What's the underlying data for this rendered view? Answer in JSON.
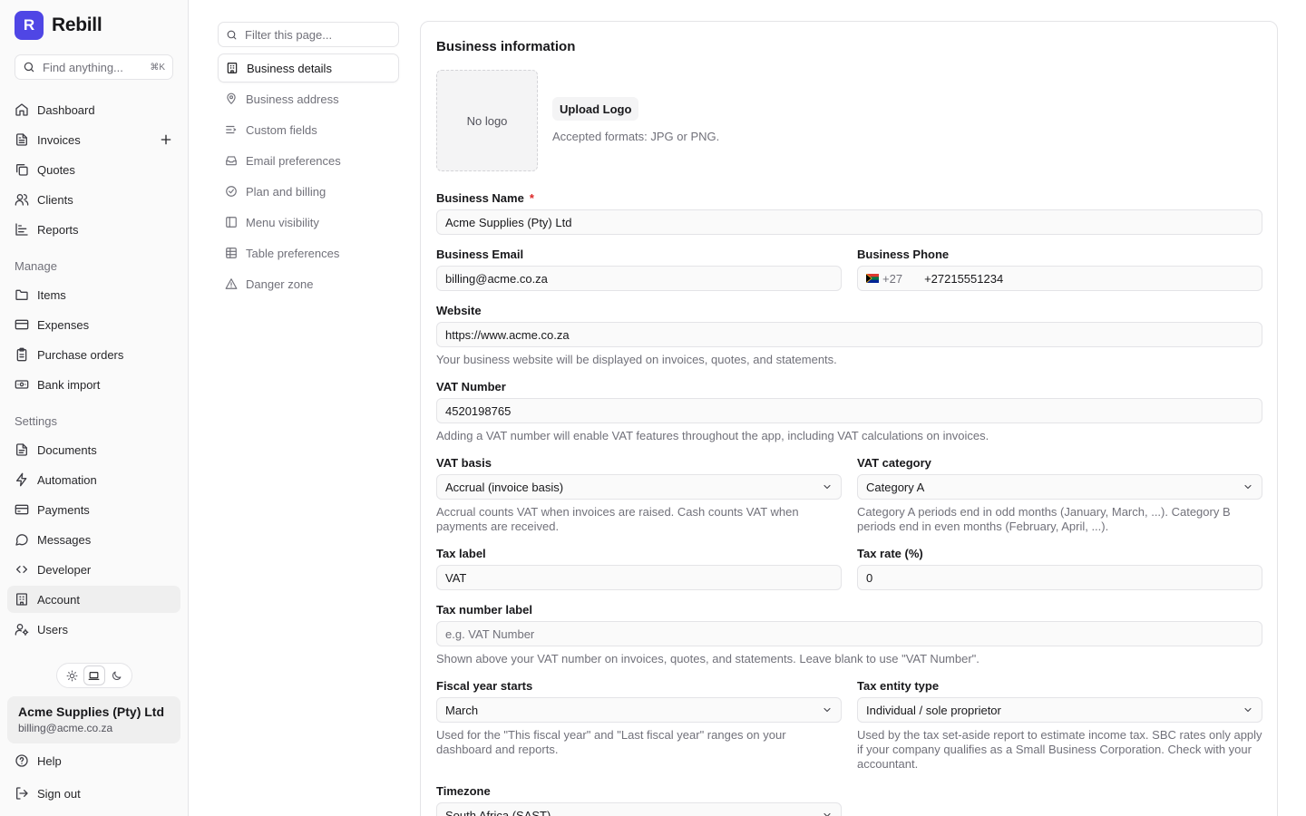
{
  "app": {
    "name": "Rebill",
    "logo_letter": "R",
    "brand_color": "#4f46e5"
  },
  "sidebar": {
    "search": {
      "placeholder": "Find anything...",
      "shortcut": "⌘K"
    },
    "main_items": [
      {
        "label": "Dashboard",
        "icon": "home-icon"
      },
      {
        "label": "Invoices",
        "icon": "file-text-icon"
      },
      {
        "label": "Quotes",
        "icon": "files-icon"
      },
      {
        "label": "Clients",
        "icon": "users-icon"
      },
      {
        "label": "Reports",
        "icon": "bar-chart-icon"
      }
    ],
    "manage_label": "Manage",
    "manage_items": [
      {
        "label": "Items",
        "icon": "folder-icon"
      },
      {
        "label": "Expenses",
        "icon": "credit-card-icon"
      },
      {
        "label": "Purchase orders",
        "icon": "clipboard-icon"
      },
      {
        "label": "Bank import",
        "icon": "banknote-icon"
      }
    ],
    "settings_label": "Settings",
    "settings_items": [
      {
        "label": "Documents",
        "icon": "document-icon"
      },
      {
        "label": "Automation",
        "icon": "zap-icon"
      },
      {
        "label": "Payments",
        "icon": "wallet-icon"
      },
      {
        "label": "Messages",
        "icon": "message-icon"
      },
      {
        "label": "Developer",
        "icon": "code-icon"
      },
      {
        "label": "Account",
        "icon": "building-icon",
        "active": true
      },
      {
        "label": "Users",
        "icon": "user-cog-icon"
      }
    ],
    "theme": {
      "options": [
        "light",
        "system",
        "dark"
      ],
      "selected": "system"
    },
    "account": {
      "name": "Acme Supplies (Pty) Ltd",
      "email": "billing@acme.co.za"
    },
    "help_label": "Help",
    "signout_label": "Sign out"
  },
  "subnav": {
    "filter_placeholder": "Filter this page...",
    "items": [
      {
        "label": "Business details",
        "icon": "building-icon",
        "active": true
      },
      {
        "label": "Business address",
        "icon": "map-pin-icon"
      },
      {
        "label": "Custom fields",
        "icon": "list-icon"
      },
      {
        "label": "Email preferences",
        "icon": "inbox-icon"
      },
      {
        "label": "Plan and billing",
        "icon": "check-circle-icon"
      },
      {
        "label": "Menu visibility",
        "icon": "panel-icon"
      },
      {
        "label": "Table preferences",
        "icon": "table-icon"
      },
      {
        "label": "Danger zone",
        "icon": "warning-icon"
      }
    ]
  },
  "form": {
    "title": "Business information",
    "logo": {
      "empty_text": "No logo",
      "upload_label": "Upload Logo",
      "formats_hint": "Accepted formats: JPG or PNG."
    },
    "business_name": {
      "label": "Business Name",
      "required_mark": "*",
      "value": "Acme Supplies (Pty) Ltd"
    },
    "business_email": {
      "label": "Business Email",
      "value": "billing@acme.co.za"
    },
    "business_phone": {
      "label": "Business Phone",
      "country_code": "+27",
      "value": "+27215551234"
    },
    "website": {
      "label": "Website",
      "value": "https://www.acme.co.za",
      "hint": "Your business website will be displayed on invoices, quotes, and statements."
    },
    "vat_number": {
      "label": "VAT Number",
      "value": "4520198765",
      "hint": "Adding a VAT number will enable VAT features throughout the app, including VAT calculations on invoices."
    },
    "vat_basis": {
      "label": "VAT basis",
      "value": "Accrual (invoice basis)",
      "hint_line1": "Accrual counts VAT when invoices are raised. Cash counts VAT when",
      "hint_line2": "payments are received."
    },
    "vat_category": {
      "label": "VAT category",
      "value": "Category A",
      "hint_line1": "Category A periods end in odd months (January, March, ...). Category B",
      "hint_line2": "periods end in even months (February, April, ...)."
    },
    "tax_label": {
      "label": "Tax label",
      "value": "VAT"
    },
    "tax_rate": {
      "label": "Tax rate (%)",
      "value": "0"
    },
    "tax_number_label": {
      "label": "Tax number label",
      "placeholder": "e.g. VAT Number",
      "hint": "Shown above your VAT number on invoices, quotes, and statements. Leave blank to use \"VAT Number\"."
    },
    "fiscal_year": {
      "label": "Fiscal year starts",
      "value": "March",
      "hint_line1": "Used for the \"This fiscal year\" and \"Last fiscal year\" ranges on your",
      "hint_line2": "dashboard and reports."
    },
    "tax_entity": {
      "label": "Tax entity type",
      "value": "Individual / sole proprietor",
      "hint_line1": "Used by the tax set-aside report to estimate income tax. SBC rates only apply",
      "hint_line2": "if your company qualifies as a Small Business Corporation. Check with your",
      "hint_line3": "accountant."
    },
    "timezone": {
      "label": "Timezone",
      "value": "South Africa (SAST)"
    }
  }
}
